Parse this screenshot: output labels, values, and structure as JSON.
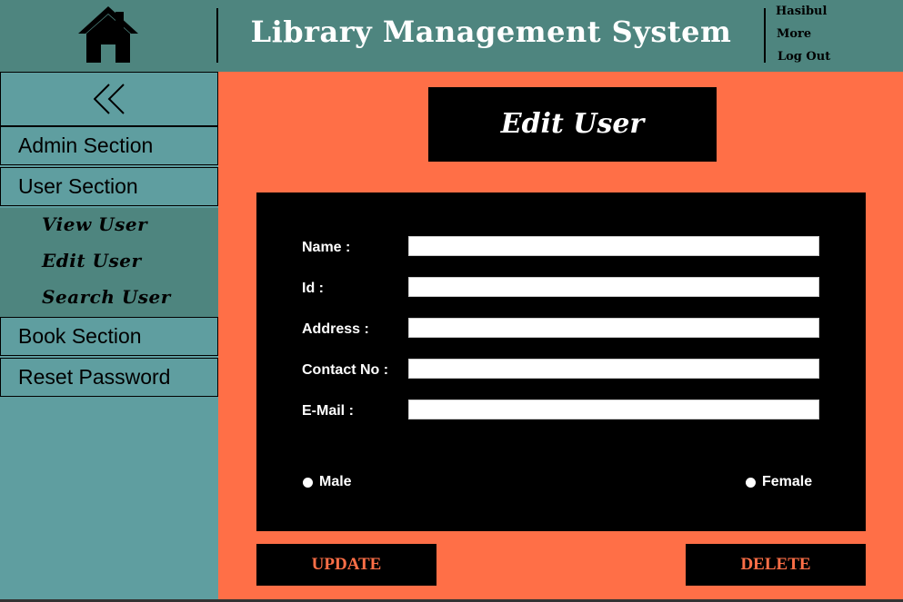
{
  "header": {
    "title": "Library Management System",
    "user_name": "Hasibul",
    "more_label": "More",
    "logout_label": "Log Out"
  },
  "sidebar": {
    "collapse_icon": "double-chevron-left-icon",
    "items": [
      {
        "label": "Admin Section"
      },
      {
        "label": "User Section"
      },
      {
        "label": "Book Section"
      },
      {
        "label": "Reset Password"
      }
    ],
    "user_sub_items": [
      {
        "label": "View User"
      },
      {
        "label": "Edit User"
      },
      {
        "label": "Search User"
      }
    ]
  },
  "main": {
    "page_title": "Edit User",
    "form": {
      "fields": [
        {
          "label": "Name :",
          "value": ""
        },
        {
          "label": "Id :",
          "value": ""
        },
        {
          "label": "Address :",
          "value": ""
        },
        {
          "label": "Contact No :",
          "value": ""
        },
        {
          "label": "E-Mail :",
          "value": ""
        }
      ],
      "gender_options": [
        {
          "label": "Male"
        },
        {
          "label": "Female"
        }
      ]
    },
    "update_label": "UPDATE",
    "delete_label": "DELETE"
  },
  "colors": {
    "header_bg": "#4e857f",
    "sidebar_bg": "#5f9ea0",
    "main_bg": "#ff6f47",
    "panel_bg": "#000000",
    "button_text": "#ff6f47"
  }
}
